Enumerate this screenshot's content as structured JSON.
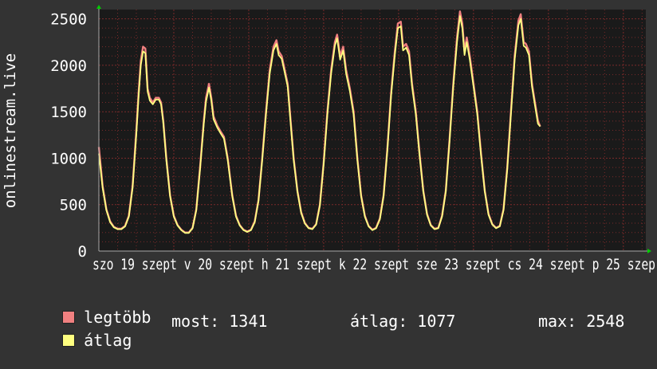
{
  "chart_data": {
    "type": "line",
    "ylabel": "onlinestream.live",
    "ylim": [
      0,
      2600
    ],
    "yticks": [
      0,
      500,
      1000,
      1500,
      2000,
      2500
    ],
    "grid": true,
    "x_tick_labels": [
      "szo 19 szept",
      "v 20 szept",
      "h 21 szept",
      "k 22 szept",
      "sze 23 szept",
      "cs 24 szept",
      "p 25 szept"
    ],
    "x_tick_text": "szo 19 szept v 20 szept h 21 szept k 22 szept sze 23 szept cs 24 szept p 25 szep",
    "x_range_days": [
      0,
      7.3
    ],
    "series": [
      {
        "name": "legtöbb",
        "color": "#f08080",
        "points": [
          [
            0.0,
            1120
          ],
          [
            0.05,
            700
          ],
          [
            0.1,
            450
          ],
          [
            0.15,
            320
          ],
          [
            0.2,
            260
          ],
          [
            0.25,
            240
          ],
          [
            0.3,
            240
          ],
          [
            0.35,
            270
          ],
          [
            0.4,
            380
          ],
          [
            0.45,
            700
          ],
          [
            0.5,
            1300
          ],
          [
            0.53,
            1700
          ],
          [
            0.56,
            2050
          ],
          [
            0.59,
            2200
          ],
          [
            0.62,
            2180
          ],
          [
            0.65,
            1750
          ],
          [
            0.68,
            1650
          ],
          [
            0.72,
            1600
          ],
          [
            0.76,
            1650
          ],
          [
            0.8,
            1650
          ],
          [
            0.83,
            1600
          ],
          [
            0.86,
            1400
          ],
          [
            0.9,
            1000
          ],
          [
            0.95,
            600
          ],
          [
            1.0,
            380
          ],
          [
            1.05,
            280
          ],
          [
            1.1,
            230
          ],
          [
            1.15,
            200
          ],
          [
            1.2,
            200
          ],
          [
            1.25,
            250
          ],
          [
            1.3,
            450
          ],
          [
            1.35,
            900
          ],
          [
            1.4,
            1400
          ],
          [
            1.43,
            1650
          ],
          [
            1.47,
            1800
          ],
          [
            1.5,
            1650
          ],
          [
            1.53,
            1450
          ],
          [
            1.58,
            1350
          ],
          [
            1.63,
            1280
          ],
          [
            1.67,
            1230
          ],
          [
            1.72,
            1000
          ],
          [
            1.78,
            600
          ],
          [
            1.83,
            380
          ],
          [
            1.88,
            280
          ],
          [
            1.93,
            230
          ],
          [
            1.98,
            210
          ],
          [
            2.03,
            230
          ],
          [
            2.08,
            320
          ],
          [
            2.13,
            550
          ],
          [
            2.18,
            1000
          ],
          [
            2.23,
            1500
          ],
          [
            2.28,
            1950
          ],
          [
            2.33,
            2200
          ],
          [
            2.37,
            2270
          ],
          [
            2.4,
            2150
          ],
          [
            2.44,
            2100
          ],
          [
            2.48,
            1950
          ],
          [
            2.52,
            1800
          ],
          [
            2.55,
            1500
          ],
          [
            2.6,
            1000
          ],
          [
            2.65,
            650
          ],
          [
            2.7,
            420
          ],
          [
            2.75,
            300
          ],
          [
            2.8,
            250
          ],
          [
            2.85,
            240
          ],
          [
            2.9,
            290
          ],
          [
            2.95,
            500
          ],
          [
            3.0,
            950
          ],
          [
            3.05,
            1500
          ],
          [
            3.1,
            1950
          ],
          [
            3.15,
            2250
          ],
          [
            3.18,
            2330
          ],
          [
            3.22,
            2100
          ],
          [
            3.26,
            2200
          ],
          [
            3.3,
            1950
          ],
          [
            3.35,
            1750
          ],
          [
            3.4,
            1500
          ],
          [
            3.45,
            1000
          ],
          [
            3.5,
            600
          ],
          [
            3.55,
            380
          ],
          [
            3.6,
            270
          ],
          [
            3.65,
            230
          ],
          [
            3.7,
            250
          ],
          [
            3.75,
            350
          ],
          [
            3.8,
            600
          ],
          [
            3.85,
            1100
          ],
          [
            3.9,
            1700
          ],
          [
            3.95,
            2150
          ],
          [
            3.99,
            2450
          ],
          [
            4.03,
            2470
          ],
          [
            4.06,
            2200
          ],
          [
            4.1,
            2230
          ],
          [
            4.14,
            2150
          ],
          [
            4.18,
            1800
          ],
          [
            4.23,
            1500
          ],
          [
            4.28,
            1050
          ],
          [
            4.33,
            650
          ],
          [
            4.38,
            400
          ],
          [
            4.43,
            280
          ],
          [
            4.48,
            240
          ],
          [
            4.53,
            250
          ],
          [
            4.58,
            380
          ],
          [
            4.63,
            650
          ],
          [
            4.68,
            1200
          ],
          [
            4.73,
            1800
          ],
          [
            4.78,
            2300
          ],
          [
            4.82,
            2580
          ],
          [
            4.85,
            2450
          ],
          [
            4.88,
            2150
          ],
          [
            4.91,
            2300
          ],
          [
            4.95,
            2100
          ],
          [
            5.0,
            1800
          ],
          [
            5.05,
            1500
          ],
          [
            5.1,
            1050
          ],
          [
            5.15,
            650
          ],
          [
            5.2,
            400
          ],
          [
            5.25,
            290
          ],
          [
            5.3,
            250
          ],
          [
            5.35,
            270
          ],
          [
            5.4,
            450
          ],
          [
            5.45,
            900
          ],
          [
            5.5,
            1500
          ],
          [
            5.55,
            2100
          ],
          [
            5.6,
            2480
          ],
          [
            5.63,
            2550
          ],
          [
            5.67,
            2250
          ],
          [
            5.7,
            2230
          ],
          [
            5.74,
            2150
          ],
          [
            5.78,
            1800
          ],
          [
            5.82,
            1600
          ],
          [
            5.86,
            1400
          ],
          [
            5.89,
            1341
          ]
        ]
      },
      {
        "name": "átlag",
        "color": "#ffff80",
        "points": [
          [
            0.0,
            1050
          ],
          [
            0.05,
            680
          ],
          [
            0.1,
            440
          ],
          [
            0.15,
            310
          ],
          [
            0.2,
            255
          ],
          [
            0.25,
            235
          ],
          [
            0.3,
            235
          ],
          [
            0.35,
            265
          ],
          [
            0.4,
            370
          ],
          [
            0.45,
            680
          ],
          [
            0.5,
            1260
          ],
          [
            0.53,
            1660
          ],
          [
            0.56,
            2000
          ],
          [
            0.59,
            2150
          ],
          [
            0.62,
            2130
          ],
          [
            0.65,
            1720
          ],
          [
            0.68,
            1620
          ],
          [
            0.72,
            1580
          ],
          [
            0.76,
            1630
          ],
          [
            0.8,
            1630
          ],
          [
            0.83,
            1580
          ],
          [
            0.86,
            1380
          ],
          [
            0.9,
            980
          ],
          [
            0.95,
            590
          ],
          [
            1.0,
            370
          ],
          [
            1.05,
            275
          ],
          [
            1.1,
            225
          ],
          [
            1.15,
            195
          ],
          [
            1.2,
            195
          ],
          [
            1.25,
            245
          ],
          [
            1.3,
            440
          ],
          [
            1.35,
            880
          ],
          [
            1.4,
            1370
          ],
          [
            1.43,
            1610
          ],
          [
            1.47,
            1760
          ],
          [
            1.5,
            1620
          ],
          [
            1.53,
            1420
          ],
          [
            1.58,
            1330
          ],
          [
            1.63,
            1260
          ],
          [
            1.67,
            1210
          ],
          [
            1.72,
            980
          ],
          [
            1.78,
            590
          ],
          [
            1.83,
            370
          ],
          [
            1.88,
            275
          ],
          [
            1.93,
            225
          ],
          [
            1.98,
            205
          ],
          [
            2.03,
            225
          ],
          [
            2.08,
            310
          ],
          [
            2.13,
            540
          ],
          [
            2.18,
            980
          ],
          [
            2.23,
            1470
          ],
          [
            2.28,
            1910
          ],
          [
            2.33,
            2160
          ],
          [
            2.37,
            2230
          ],
          [
            2.4,
            2110
          ],
          [
            2.44,
            2070
          ],
          [
            2.48,
            1920
          ],
          [
            2.52,
            1770
          ],
          [
            2.55,
            1470
          ],
          [
            2.6,
            980
          ],
          [
            2.65,
            640
          ],
          [
            2.7,
            410
          ],
          [
            2.75,
            295
          ],
          [
            2.8,
            245
          ],
          [
            2.85,
            235
          ],
          [
            2.9,
            285
          ],
          [
            2.95,
            490
          ],
          [
            3.0,
            930
          ],
          [
            3.05,
            1470
          ],
          [
            3.1,
            1910
          ],
          [
            3.15,
            2210
          ],
          [
            3.18,
            2290
          ],
          [
            3.22,
            2060
          ],
          [
            3.26,
            2160
          ],
          [
            3.3,
            1910
          ],
          [
            3.35,
            1720
          ],
          [
            3.4,
            1470
          ],
          [
            3.45,
            980
          ],
          [
            3.5,
            590
          ],
          [
            3.55,
            370
          ],
          [
            3.6,
            265
          ],
          [
            3.65,
            225
          ],
          [
            3.7,
            245
          ],
          [
            3.75,
            340
          ],
          [
            3.8,
            590
          ],
          [
            3.85,
            1080
          ],
          [
            3.9,
            1670
          ],
          [
            3.95,
            2110
          ],
          [
            3.99,
            2400
          ],
          [
            4.03,
            2420
          ],
          [
            4.06,
            2160
          ],
          [
            4.1,
            2190
          ],
          [
            4.14,
            2110
          ],
          [
            4.18,
            1770
          ],
          [
            4.23,
            1470
          ],
          [
            4.28,
            1030
          ],
          [
            4.33,
            640
          ],
          [
            4.38,
            390
          ],
          [
            4.43,
            275
          ],
          [
            4.48,
            235
          ],
          [
            4.53,
            245
          ],
          [
            4.58,
            370
          ],
          [
            4.63,
            640
          ],
          [
            4.68,
            1180
          ],
          [
            4.73,
            1770
          ],
          [
            4.78,
            2250
          ],
          [
            4.82,
            2530
          ],
          [
            4.85,
            2400
          ],
          [
            4.88,
            2110
          ],
          [
            4.91,
            2250
          ],
          [
            4.95,
            2060
          ],
          [
            5.0,
            1770
          ],
          [
            5.05,
            1470
          ],
          [
            5.1,
            1030
          ],
          [
            5.15,
            640
          ],
          [
            5.2,
            390
          ],
          [
            5.25,
            285
          ],
          [
            5.3,
            245
          ],
          [
            5.35,
            265
          ],
          [
            5.4,
            440
          ],
          [
            5.45,
            880
          ],
          [
            5.5,
            1470
          ],
          [
            5.55,
            2060
          ],
          [
            5.6,
            2430
          ],
          [
            5.63,
            2500
          ],
          [
            5.67,
            2210
          ],
          [
            5.7,
            2190
          ],
          [
            5.74,
            2110
          ],
          [
            5.78,
            1770
          ],
          [
            5.82,
            1570
          ],
          [
            5.86,
            1370
          ],
          [
            5.89,
            1341
          ]
        ]
      }
    ]
  },
  "legend": {
    "items": [
      {
        "label": "legtöbb",
        "color": "#f08080"
      },
      {
        "label": "átlag",
        "color": "#ffff80"
      }
    ]
  },
  "stats": {
    "now_label": "most:",
    "now_value": "1341",
    "avg_label": "átlag:",
    "avg_value": "1077",
    "max_label": "max:",
    "max_value": "2548"
  },
  "colors": {
    "background": "#333333",
    "plot_background": "#1a1a1a",
    "grid": "#7a2a2a",
    "arrow": "#00cc00"
  }
}
